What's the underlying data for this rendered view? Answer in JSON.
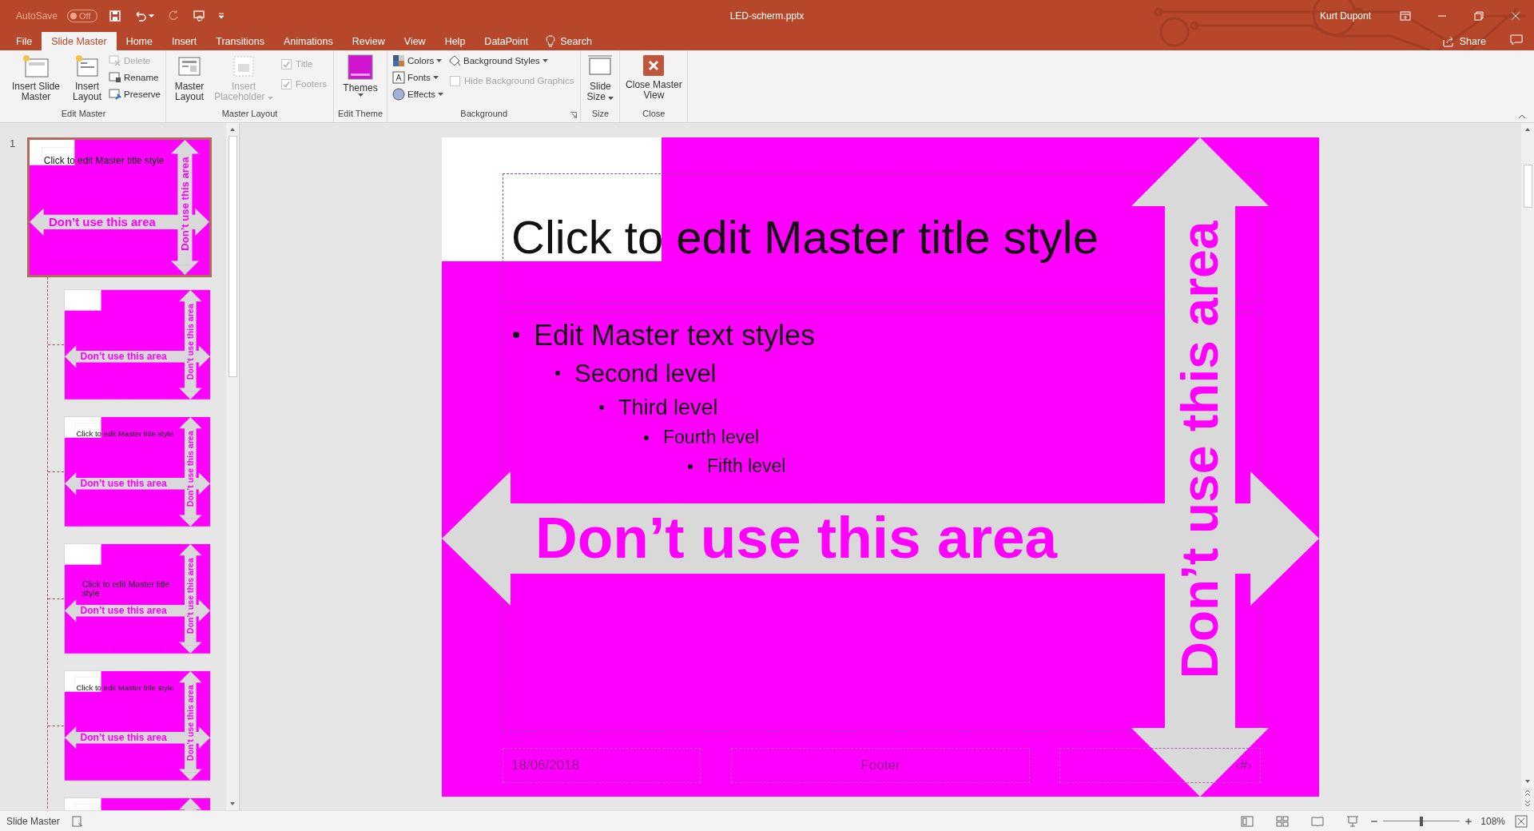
{
  "title_bar": {
    "autosave": {
      "label": "AutoSave",
      "on": false,
      "state_text": "Off"
    },
    "file_name": "LED-scherm.pptx",
    "user": "Kurt Dupont"
  },
  "tabs": [
    {
      "label": "File",
      "selected": false
    },
    {
      "label": "Slide Master",
      "selected": true
    },
    {
      "label": "Home",
      "selected": false
    },
    {
      "label": "Insert",
      "selected": false
    },
    {
      "label": "Transitions",
      "selected": false
    },
    {
      "label": "Animations",
      "selected": false
    },
    {
      "label": "Review",
      "selected": false
    },
    {
      "label": "View",
      "selected": false
    },
    {
      "label": "Help",
      "selected": false
    },
    {
      "label": "DataPoint",
      "selected": false
    }
  ],
  "search": {
    "label": "Search"
  },
  "share": {
    "label": "Share"
  },
  "ribbon_groups": [
    {
      "label": "Edit Master",
      "items": [
        {
          "kind": "large",
          "label": "Insert Slide Master",
          "disabled": false
        },
        {
          "kind": "large",
          "label": "Insert Layout",
          "disabled": false
        },
        {
          "kind": "small",
          "label": "Delete",
          "disabled": true
        },
        {
          "kind": "small",
          "label": "Rename",
          "disabled": false
        },
        {
          "kind": "small",
          "label": "Preserve",
          "disabled": false
        }
      ]
    },
    {
      "label": "Master Layout",
      "items": [
        {
          "kind": "large",
          "label": "Master Layout",
          "disabled": false
        },
        {
          "kind": "large",
          "label": "Insert Placeholder",
          "disabled": true,
          "dropdown": true
        },
        {
          "kind": "check",
          "label": "Title",
          "checked": true,
          "disabled": true
        },
        {
          "kind": "check",
          "label": "Footers",
          "checked": true,
          "disabled": true
        }
      ]
    },
    {
      "label": "Edit Theme",
      "items": [
        {
          "kind": "large",
          "label": "Themes",
          "disabled": false,
          "dropdown": true
        }
      ]
    },
    {
      "label": "Background",
      "launcher": true,
      "items": [
        {
          "kind": "small",
          "label": "Colors",
          "disabled": false,
          "dropdown": true
        },
        {
          "kind": "small",
          "label": "Fonts",
          "disabled": false,
          "dropdown": true
        },
        {
          "kind": "small",
          "label": "Effects",
          "disabled": false,
          "dropdown": true
        },
        {
          "kind": "small",
          "label": "Background Styles",
          "disabled": false,
          "dropdown": true
        },
        {
          "kind": "check",
          "label": "Hide Background Graphics",
          "checked": false,
          "disabled": true
        }
      ]
    },
    {
      "label": "Size",
      "items": [
        {
          "kind": "large",
          "label": "Slide Size",
          "disabled": false,
          "dropdown": true
        }
      ]
    },
    {
      "label": "Close",
      "items": [
        {
          "kind": "large",
          "label": "Close Master View",
          "disabled": false
        }
      ]
    }
  ],
  "thumbnails": [
    {
      "number": "1",
      "selected": true,
      "slide": {
        "kind": "master",
        "title": "Click to edit Master title style",
        "labels": {
          "horizontal": "Don’t use this area",
          "vertical": "Don’t use this area"
        }
      }
    },
    {
      "selected": false,
      "slide": {
        "kind": "title-slide",
        "labels": {
          "horizontal": "Don’t use this area",
          "vertical": "Don’t use this area"
        }
      }
    },
    {
      "selected": false,
      "slide": {
        "kind": "title-content",
        "title": "Click to edit Master title style",
        "labels": {
          "horizontal": "Don’t use this area",
          "vertical": "Don’t use this area"
        }
      }
    },
    {
      "selected": false,
      "slide": {
        "kind": "section",
        "title": "Click to edit Master title style",
        "labels": {
          "horizontal": "Don’t use this area",
          "vertical": "Don’t use this area"
        }
      }
    },
    {
      "selected": false,
      "slide": {
        "kind": "two-content",
        "title": "Click to edit Master title style",
        "labels": {
          "horizontal": "Don’t use this area",
          "vertical": "Don’t use this area"
        }
      }
    },
    {
      "selected": false,
      "slide": {
        "kind": "partial"
      }
    }
  ],
  "slide": {
    "kind": "master",
    "title": "Click to edit Master title style",
    "body": [
      {
        "text": "Edit Master text styles",
        "children": [
          {
            "text": "Second level",
            "children": [
              {
                "text": "Third level",
                "children": [
                  {
                    "text": "Fourth level",
                    "children": [
                      {
                        "text": "Fifth level"
                      }
                    ]
                  }
                ]
              }
            ]
          }
        ]
      }
    ],
    "labels": {
      "horizontal": "Don’t use this area",
      "vertical": "Don’t use this area"
    },
    "footers": {
      "date": "18/06/2018",
      "footer": "Footer",
      "number": "‹#›"
    }
  },
  "status_bar": {
    "mode": "Slide Master",
    "zoom": "108%",
    "zoom_slider": {
      "level": 0.5
    }
  }
}
